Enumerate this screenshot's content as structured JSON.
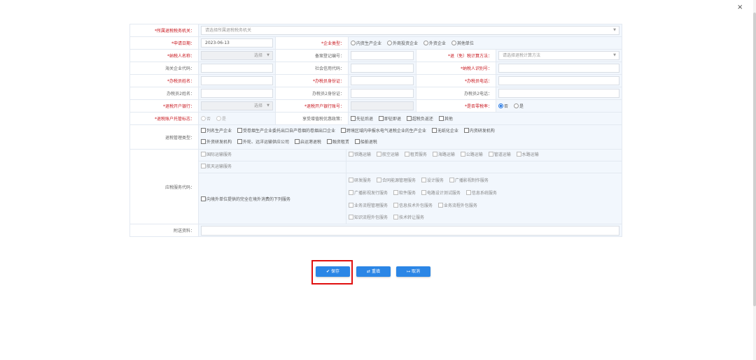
{
  "close_glyph": "×",
  "row1": {
    "label": "所属退税税务机关：",
    "placeholder": "请选择所属退税税务机关"
  },
  "row2": {
    "label": "申请日期：",
    "date": "2023-06-13",
    "type_label": "企业类型：",
    "types": [
      "内资生产企业",
      "外商投资企业",
      "外资企业",
      "其他单位"
    ],
    "selected_type": 0
  },
  "row3": {
    "label": "纳税人名称：",
    "select_text": "选择",
    "record_label": "备案登记编号：",
    "method_label": "退（免）税计算方法：",
    "method_placeholder": "请选择退税计算方法"
  },
  "row4": {
    "customs_label": "海关企业代码：",
    "credit_label": "社会信用代码：",
    "taxid_label": "纳税人识别号："
  },
  "row5": {
    "name_label": "办税员姓名：",
    "id_label": "办税员身份证：",
    "phone_label": "办税员电话："
  },
  "row6": {
    "name2_label": "办税员2姓名：",
    "id2_label": "办税员2身份证：",
    "phone2_label": "办税员2电话："
  },
  "row7": {
    "bank_label": "退税开户银行：",
    "select_text": "选择",
    "account_label": "退税开户银行账号：",
    "zero_label": "是否零税率：",
    "options": [
      "否",
      "是"
    ],
    "selected": 0
  },
  "row8": {
    "entrust_label": "退税账户托管标志：",
    "options": [
      "否",
      "是"
    ],
    "policy_label": "享受增值税优惠政策：",
    "policies": [
      "先征后退",
      "即征即退",
      "超税负返还",
      "其他"
    ]
  },
  "mgmt": {
    "label": "退税管理类型：",
    "line1": [
      "列名生产企业",
      "受卷烟生产企业委托出口自产卷烟的卷烟出口企业",
      "跨境区域内申报水电气退税企业的生产企业",
      "无纸化企业",
      "内资研发机构"
    ],
    "line2": [
      "外资研发机构",
      "外轮、远洋运输供应公司",
      "启运港退税",
      "融资租赁",
      "船舶退税"
    ]
  },
  "services": {
    "label": "应税服务代码：",
    "intl": "国际运输服务",
    "transport": [
      "铁路运输",
      "航空运输",
      "租赁服务",
      "海路运输",
      "公路运输",
      "管道运输",
      "水路运输"
    ],
    "space": "航天运输服务",
    "foreign": "向境外单位提供的完全在境外消费的下列服务",
    "list1": [
      "研发服务",
      "合同能源管理服务",
      "设计服务",
      "广播影视制作服务"
    ],
    "list2": [
      "广播影视发行服务",
      "软件服务",
      "电路设计测试服务",
      "信息系统服务"
    ],
    "list3": [
      "业务流程管理服务",
      "信息技术外包服务",
      "业务流程外包服务"
    ],
    "list4": [
      "知识流程外包服务",
      "技术转让服务"
    ]
  },
  "attach": {
    "label": "附送资料："
  },
  "buttons": {
    "save": "保存",
    "reset": "重填",
    "cancel": "取消"
  },
  "colors": {
    "accent": "#2b86e6",
    "required": "#c8161d",
    "highlight": "#e01010",
    "value_bg": "#f2f7fd"
  }
}
